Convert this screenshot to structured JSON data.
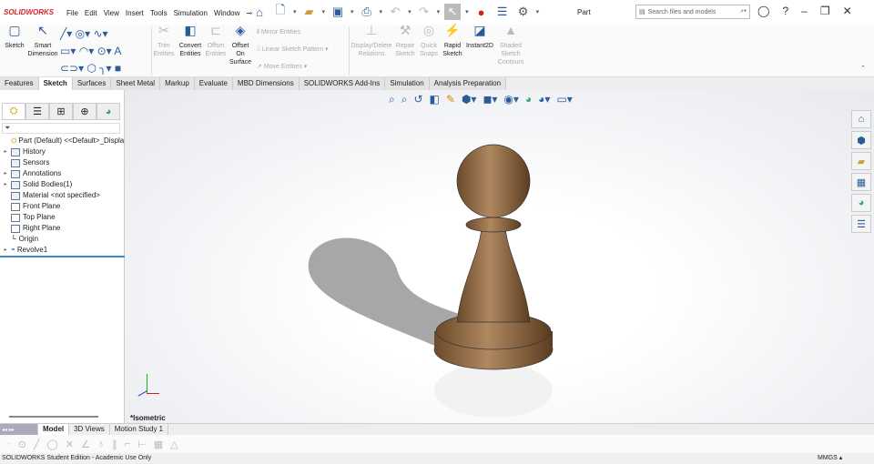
{
  "app": {
    "logo": "SOLIDWORKS",
    "title": "Part"
  },
  "menu": [
    "File",
    "Edit",
    "View",
    "Insert",
    "Tools",
    "Simulation",
    "Window"
  ],
  "search": {
    "placeholder": "Search files and models"
  },
  "ribbon": {
    "sketch": "Sketch",
    "smart_dim": "Smart Dimension",
    "trim": "Trim Entities",
    "convert": "Convert Entities",
    "offset": "Offset Entities",
    "offset_surface": "Offset On Surface",
    "mirror": "Mirror Entities",
    "linear_pattern": "Linear Sketch Pattern",
    "move": "Move Entities",
    "display_delete": "Display/Delete Relations",
    "repair": "Repair Sketch",
    "quick_snaps": "Quick Snaps",
    "rapid": "Rapid Sketch",
    "instant2d": "Instant2D",
    "shaded": "Shaded Sketch Contours"
  },
  "tabs": [
    "Features",
    "Sketch",
    "Surfaces",
    "Sheet Metal",
    "Markup",
    "Evaluate",
    "MBD Dimensions",
    "SOLIDWORKS Add-Ins",
    "Simulation",
    "Analysis Preparation"
  ],
  "active_tab": "Sketch",
  "tree": [
    {
      "label": "Part (Default) <<Default>_Displa",
      "expand": false
    },
    {
      "label": "History",
      "expand": true
    },
    {
      "label": "Sensors",
      "expand": false
    },
    {
      "label": "Annotations",
      "expand": true
    },
    {
      "label": "Solid Bodies(1)",
      "expand": true
    },
    {
      "label": "Material <not specified>",
      "expand": false
    },
    {
      "label": "Front Plane",
      "expand": false
    },
    {
      "label": "Top Plane",
      "expand": false
    },
    {
      "label": "Right Plane",
      "expand": false
    },
    {
      "label": "Origin",
      "expand": false
    },
    {
      "label": "Revolve1",
      "expand": true
    }
  ],
  "view": {
    "orientation": "*Isometric"
  },
  "bottom_tabs": [
    "Model",
    "3D Views",
    "Motion Study 1"
  ],
  "status": {
    "text": "SOLIDWORKS Student Edition - Academic Use Only",
    "units": "MMGS"
  }
}
